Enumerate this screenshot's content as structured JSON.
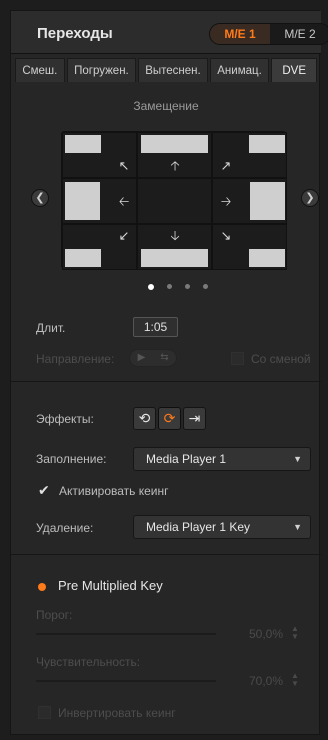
{
  "header": {
    "title": "Переходы",
    "me_buttons": [
      "M/E 1",
      "M/E 2"
    ]
  },
  "tabs": [
    "Смеш.",
    "Погружен.",
    "Вытеснен.",
    "Анимац.",
    "DVE"
  ],
  "dve": {
    "section_title": "Замещение",
    "nav_prev_icon": "chevron-left-icon",
    "nav_next_icon": "chevron-right-icon",
    "page_count": 4,
    "active_page": 1
  },
  "duration": {
    "label": "Длит.",
    "value": "1:05"
  },
  "direction": {
    "label": "Направление:",
    "mix_label": "Со сменой"
  },
  "effects": {
    "label": "Эффекты:"
  },
  "fill": {
    "label": "Заполнение:",
    "value": "Media Player 1"
  },
  "enable_key": {
    "label": "Активировать кеинг",
    "checked": true
  },
  "key": {
    "label": "Удаление:",
    "value": "Media Player 1 Key"
  },
  "premult": {
    "label": "Pre Multiplied Key",
    "clip_label": "Порог:",
    "clip_value": "50,0%",
    "gain_label": "Чувствительность:",
    "gain_value": "70,0%",
    "invert_label": "Инвертировать кеинг"
  },
  "colors": {
    "accent": "#ff7a1a",
    "panel": "#262626",
    "background": "#1d1d1d"
  }
}
